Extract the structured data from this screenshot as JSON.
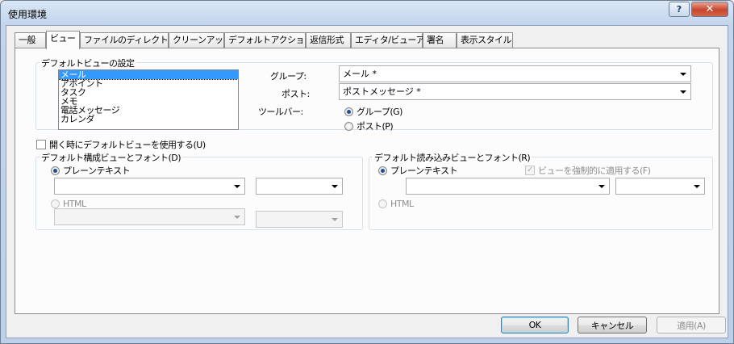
{
  "window": {
    "title": "使用環境",
    "help_label": "?",
    "close_label": "✕"
  },
  "tabs": [
    {
      "label": "一般"
    },
    {
      "label": "ビュー"
    },
    {
      "label": "ファイルのディレクトリ"
    },
    {
      "label": "クリーンアップ"
    },
    {
      "label": "デフォルトアクション"
    },
    {
      "label": "返信形式"
    },
    {
      "label": "エディタ/ビューア"
    },
    {
      "label": "署名"
    },
    {
      "label": "表示スタイル"
    }
  ],
  "default_view": {
    "title": "デフォルトビューの設定",
    "list_items": [
      "メール",
      "アポイント",
      "タスク",
      "メモ",
      "電話メッセージ",
      "カレンダ"
    ],
    "selected_item": "メール",
    "group_label": "グループ:",
    "group_value": "メール *",
    "post_label": "ポスト:",
    "post_value": "ポストメッセージ *",
    "toolbar_label": "ツールバー:",
    "toolbar_group_option": "グループ(G)",
    "toolbar_post_option": "ポスト(P)"
  },
  "open_default_checkbox": "開く時にデフォルトビューを使用する(U)",
  "compose": {
    "title": "デフォルト構成ビューとフォント(D)",
    "plain_text": "プレーンテキスト",
    "html": "HTML"
  },
  "read": {
    "title": "デフォルト読み込みビューとフォント(R)",
    "plain_text": "プレーンテキスト",
    "force_view": "ビューを強制的に適用する(F)",
    "force_check": "✓",
    "html": "HTML"
  },
  "buttons": {
    "ok": "OK",
    "cancel": "キャンセル",
    "apply": "適用(A)"
  }
}
